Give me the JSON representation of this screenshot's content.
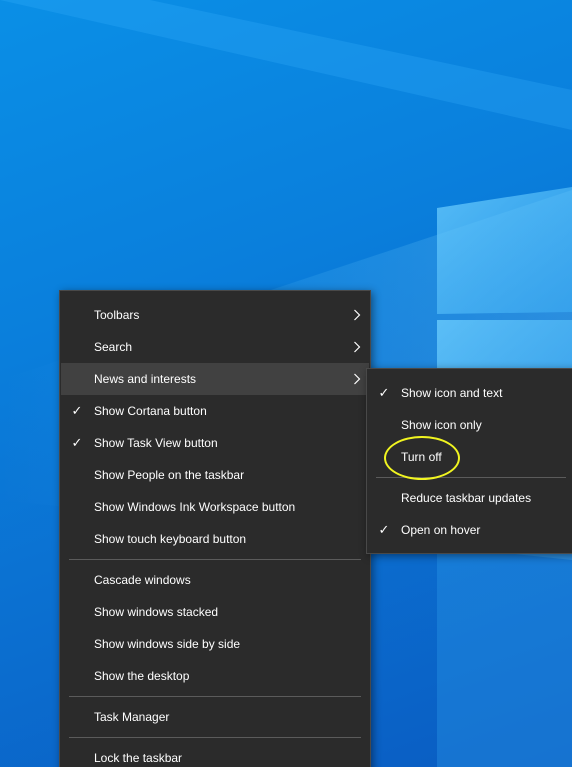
{
  "main_menu": {
    "groups": [
      [
        {
          "label": "Toolbars",
          "checked": false,
          "submenu": true
        },
        {
          "label": "Search",
          "checked": false,
          "submenu": true
        },
        {
          "label": "News and interests",
          "checked": false,
          "submenu": true,
          "active": true
        },
        {
          "label": "Show Cortana button",
          "checked": true,
          "submenu": false
        },
        {
          "label": "Show Task View button",
          "checked": true,
          "submenu": false
        },
        {
          "label": "Show People on the taskbar",
          "checked": false,
          "submenu": false
        },
        {
          "label": "Show Windows Ink Workspace button",
          "checked": false,
          "submenu": false
        },
        {
          "label": "Show touch keyboard button",
          "checked": false,
          "submenu": false
        }
      ],
      [
        {
          "label": "Cascade windows",
          "checked": false,
          "submenu": false
        },
        {
          "label": "Show windows stacked",
          "checked": false,
          "submenu": false
        },
        {
          "label": "Show windows side by side",
          "checked": false,
          "submenu": false
        },
        {
          "label": "Show the desktop",
          "checked": false,
          "submenu": false
        }
      ],
      [
        {
          "label": "Task Manager",
          "checked": false,
          "submenu": false
        }
      ],
      [
        {
          "label": "Lock the taskbar",
          "checked": false,
          "submenu": false
        }
      ]
    ]
  },
  "sub_menu": {
    "groups": [
      [
        {
          "label": "Show icon and text",
          "checked": true
        },
        {
          "label": "Show icon only",
          "checked": false
        },
        {
          "label": "Turn off",
          "checked": false,
          "annotated": true
        }
      ],
      [
        {
          "label": "Reduce taskbar updates",
          "checked": false
        },
        {
          "label": "Open on hover",
          "checked": true
        }
      ]
    ]
  },
  "glyphs": {
    "check": "✓"
  },
  "colors": {
    "menu_bg": "#2b2b2b",
    "menu_hover": "#414141",
    "annotation": "#f1f520",
    "desktop": "#0a7fdc"
  }
}
